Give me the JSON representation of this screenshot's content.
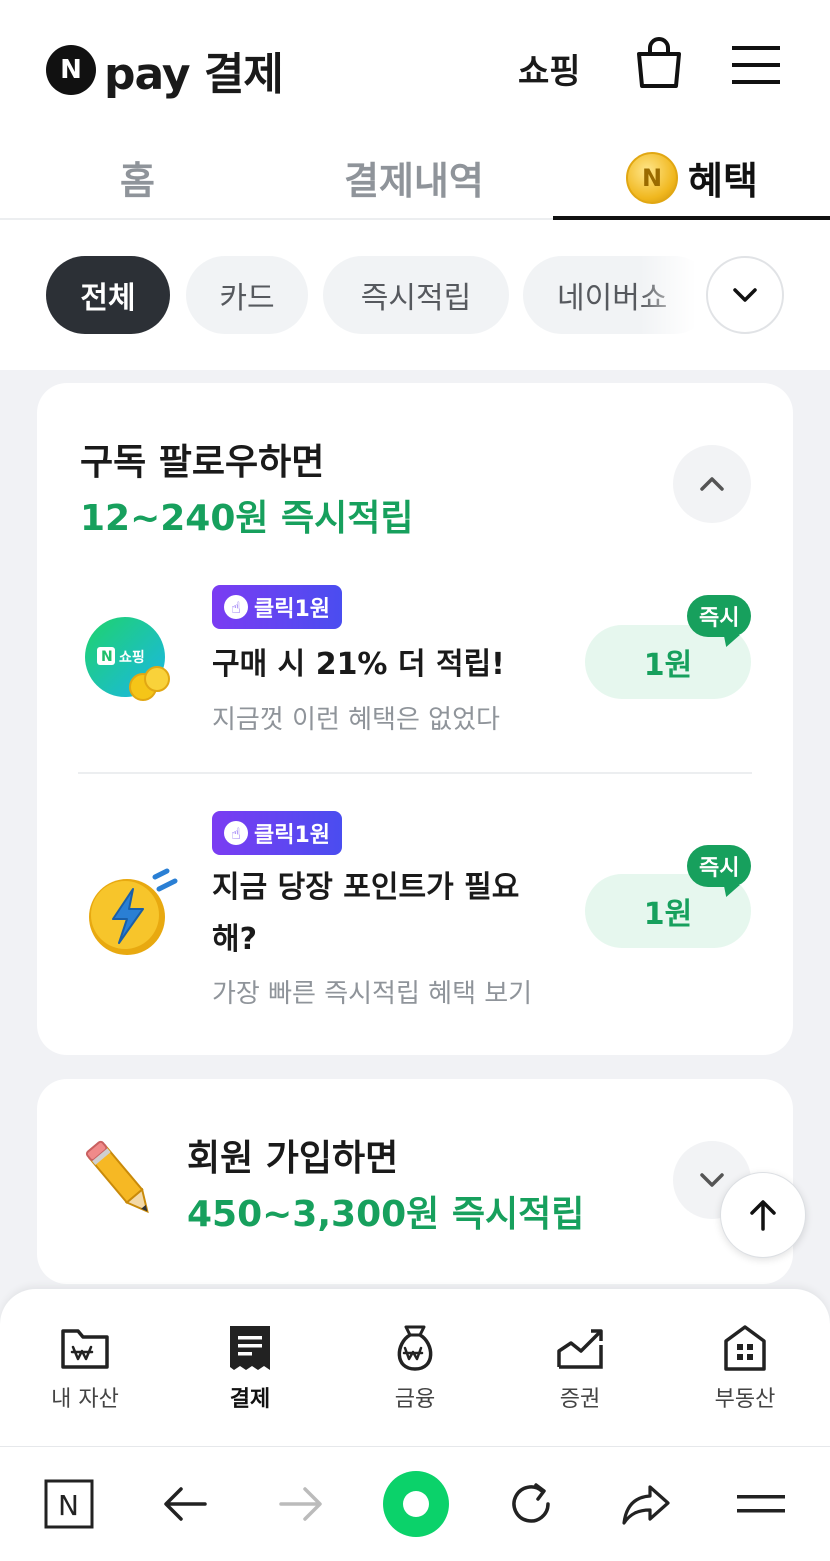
{
  "header": {
    "logo_badge": "N",
    "logo_text": "pay 결제",
    "shop_link": "쇼핑"
  },
  "tabs": [
    {
      "label": "홈"
    },
    {
      "label": "결제내역"
    },
    {
      "label": "혜택",
      "coin": "N"
    }
  ],
  "chips": [
    {
      "label": "전체"
    },
    {
      "label": "카드"
    },
    {
      "label": "즉시적립"
    },
    {
      "label": "네이버쇼"
    }
  ],
  "section1": {
    "title": "구독 팔로우하면",
    "subtitle": "12~240원 즉시적립",
    "items": [
      {
        "tag": "클릭1원",
        "title": "구매 시 21% 더 적립!",
        "desc": "지금껏 이런 혜택은 없었다",
        "reward": "1원",
        "badge": "즉시",
        "icon_text": "쇼핑",
        "icon_n": "N"
      },
      {
        "tag": "클릭1원",
        "title_line1": "지금 당장 포인트가 필요",
        "title_line2": "해?",
        "desc": "가장 빠른 즉시적립 혜택 보기",
        "reward": "1원",
        "badge": "즉시"
      }
    ]
  },
  "section2": {
    "title": "회원 가입하면",
    "subtitle": "450~3,300원 즉시적립"
  },
  "bottom_nav": [
    {
      "label": "내 자산"
    },
    {
      "label": "결제"
    },
    {
      "label": "금융"
    },
    {
      "label": "증권"
    },
    {
      "label": "부동산"
    }
  ],
  "browser": {
    "n_icon": "N"
  },
  "colors": {
    "accent_green": "#17a05d",
    "tag_purple": "#6a3ff0",
    "chip_active": "#2c3036"
  }
}
